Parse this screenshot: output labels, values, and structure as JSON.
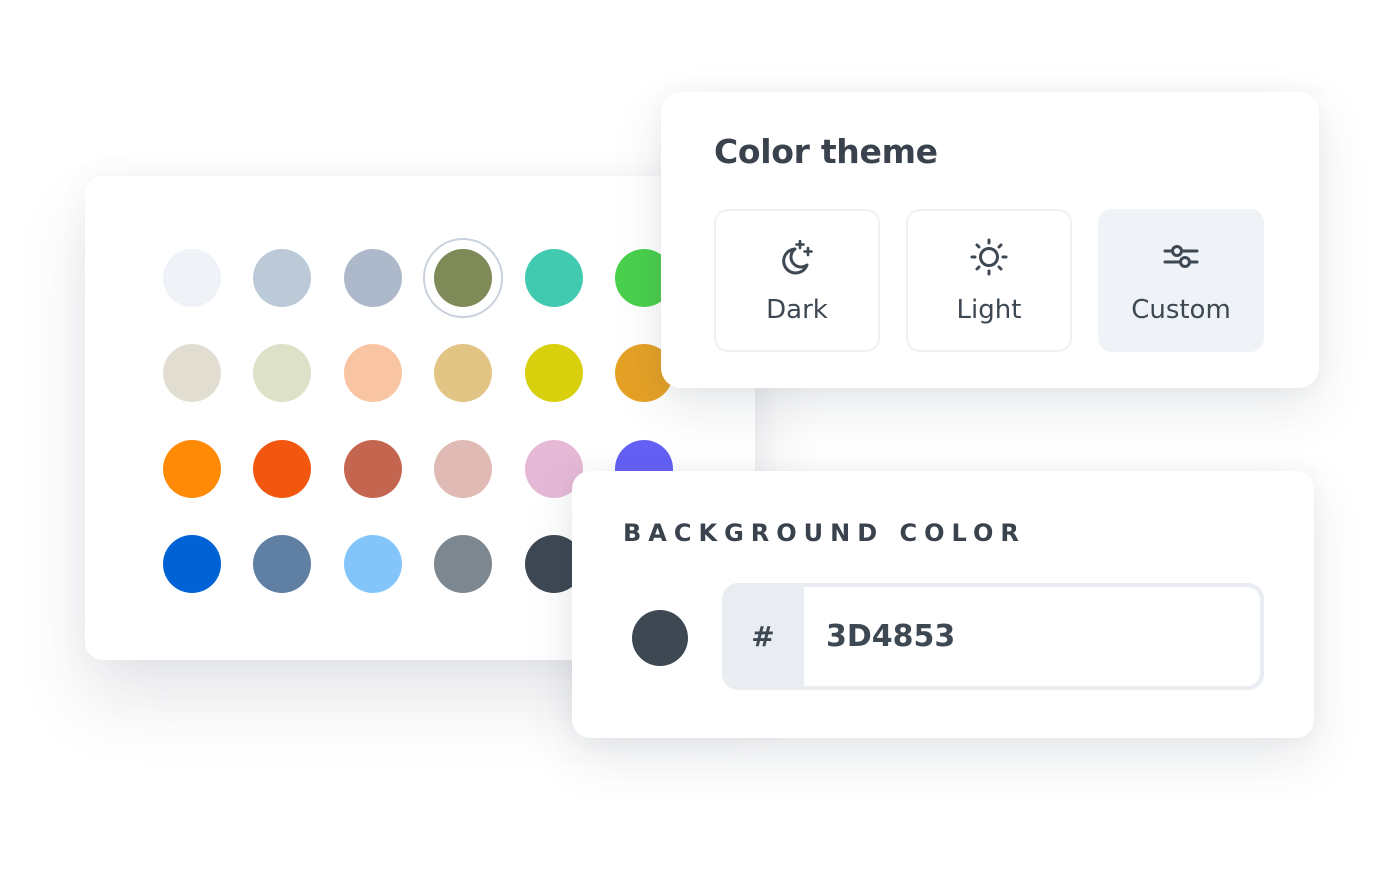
{
  "palette": {
    "selected_color": "#7e8a58",
    "rows": [
      [
        "#eff2f6",
        "#bccad8",
        "#adb9ca",
        "#7e8a58",
        "#41cab0",
        "#4ad04c"
      ],
      [
        "#e1ddd1",
        "#dde1c8",
        "#f8c4a1",
        "#e2c585",
        "#d8d00c",
        "#e5a125"
      ],
      [
        "#fe8a06",
        "#f25710",
        "#c4654f",
        "#e0bab4",
        "#e5b9d6",
        "#6460f5"
      ],
      [
        "#0062d5",
        "#5f80a3",
        "#83c5fb",
        "#7d8790",
        "#3d4853"
      ]
    ]
  },
  "theme": {
    "title": "Color theme",
    "options": [
      {
        "label": "Dark",
        "icon": "moon-stars-icon",
        "active": false
      },
      {
        "label": "Light",
        "icon": "sun-icon",
        "active": false
      },
      {
        "label": "Custom",
        "icon": "sliders-icon",
        "active": true
      }
    ],
    "icon_color": "#3d4853"
  },
  "background_color": {
    "title": "BACKGROUND COLOR",
    "prefix": "#",
    "value": "3D4853",
    "preview_color": "#3d4853"
  }
}
